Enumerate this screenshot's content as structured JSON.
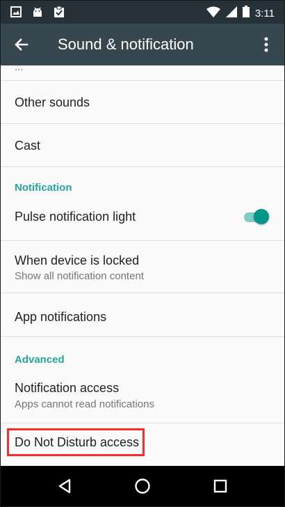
{
  "status_bar": {
    "time": "3:11",
    "left_icons": [
      "image-icon",
      "android-icon",
      "clipboard-check-icon"
    ],
    "right_icons": [
      "wifi-icon",
      "signal-icon",
      "battery-icon"
    ]
  },
  "toolbar": {
    "title": "Sound & notification",
    "back_icon": "arrow-back-icon",
    "more_icon": "more-vert-icon"
  },
  "list": {
    "items": [
      {
        "title": "Other sounds"
      },
      {
        "title": "Cast"
      },
      {
        "section": "Notification"
      },
      {
        "title": "Pulse notification light",
        "toggle": true
      },
      {
        "title": "When device is locked",
        "subtitle": "Show all notification content"
      },
      {
        "title": "App notifications"
      },
      {
        "section": "Advanced"
      },
      {
        "title": "Notification access",
        "subtitle": "Apps cannot read notifications"
      },
      {
        "title": "Do Not Disturb access",
        "highlighted": true
      }
    ]
  },
  "nav_bar": {
    "icons": [
      "back-triangle-icon",
      "home-circle-icon",
      "recents-square-icon"
    ]
  },
  "colors": {
    "status_bar": "#263238",
    "toolbar": "#37474f",
    "accent": "#009688",
    "highlight_box": "#ff2a2a"
  }
}
